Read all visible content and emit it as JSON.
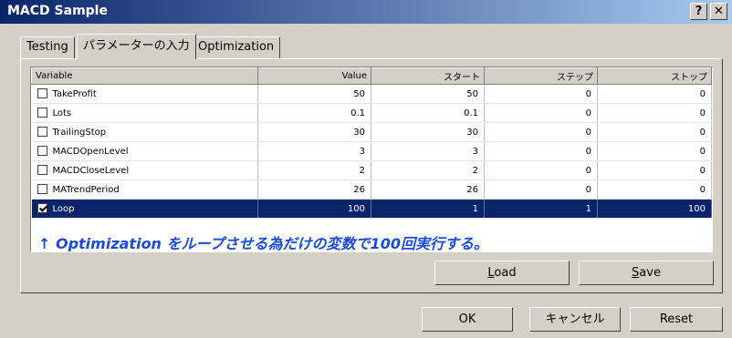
{
  "window": {
    "title": "MACD Sample",
    "help_button": "?",
    "close_button": "✕"
  },
  "tabs": [
    {
      "label": "Testing"
    },
    {
      "label": "パラメーターの入力"
    },
    {
      "label": "Optimization"
    }
  ],
  "table": {
    "headers": [
      "Variable",
      "Value",
      "スタート",
      "ステップ",
      "ストップ"
    ],
    "rows": [
      {
        "checked": false,
        "variable": "TakeProfit",
        "value": "50",
        "start": "50",
        "step": "0",
        "stop": "0"
      },
      {
        "checked": false,
        "variable": "Lots",
        "value": "0.1",
        "start": "0.1",
        "step": "0",
        "stop": "0"
      },
      {
        "checked": false,
        "variable": "TrailingStop",
        "value": "30",
        "start": "30",
        "step": "0",
        "stop": "0"
      },
      {
        "checked": false,
        "variable": "MACDOpenLevel",
        "value": "3",
        "start": "3",
        "step": "0",
        "stop": "0"
      },
      {
        "checked": false,
        "variable": "MACDCloseLevel",
        "value": "2",
        "start": "2",
        "step": "0",
        "stop": "0"
      },
      {
        "checked": false,
        "variable": "MATrendPeriod",
        "value": "26",
        "start": "26",
        "step": "0",
        "stop": "0"
      },
      {
        "checked": true,
        "variable": "Loop",
        "value": "100",
        "start": "1",
        "step": "1",
        "stop": "100"
      }
    ]
  },
  "annotation": "↑ Optimization をループさせる為だけの変数で100回実行する。",
  "panel_buttons": {
    "load": {
      "mnemonic": "L",
      "rest": "oad"
    },
    "save": {
      "mnemonic": "S",
      "rest": "ave"
    }
  },
  "dialog_buttons": {
    "ok": "OK",
    "cancel": "キャンセル",
    "reset": "Reset"
  },
  "colors": {
    "selection": "#0a246a",
    "annotation": "#1a4bdc",
    "face": "#d4d0c8"
  }
}
